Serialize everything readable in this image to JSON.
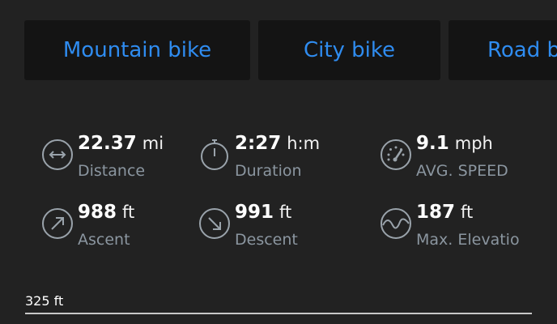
{
  "bike_types": {
    "mountain": "Mountain bike",
    "city": "City bike",
    "road": "Road bike"
  },
  "stats": {
    "distance": {
      "value": "22.37",
      "unit": "mi",
      "label": "Distance",
      "icon": "distance-arrows-icon"
    },
    "duration": {
      "value": "2:27",
      "unit": "h:m",
      "label": "Duration",
      "icon": "stopwatch-icon"
    },
    "avg_speed": {
      "value": "9.1",
      "unit": "mph",
      "label": "AVG. SPEED",
      "icon": "speedometer-icon"
    },
    "ascent": {
      "value": "988",
      "unit": "ft",
      "label": "Ascent",
      "icon": "ascent-arrow-icon"
    },
    "descent": {
      "value": "991",
      "unit": "ft",
      "label": "Descent",
      "icon": "descent-arrow-icon"
    },
    "max_elevation": {
      "value": "187",
      "unit": "ft",
      "label": "Max. Elevation",
      "icon": "elevation-profile-icon"
    }
  },
  "elevation_chart": {
    "axis_label": "325 ft"
  },
  "colors": {
    "background": "#222222",
    "tab_background": "#141414",
    "accent": "#2f8cf0",
    "label": "#8b96a0",
    "icon": "#9aa3ab"
  }
}
